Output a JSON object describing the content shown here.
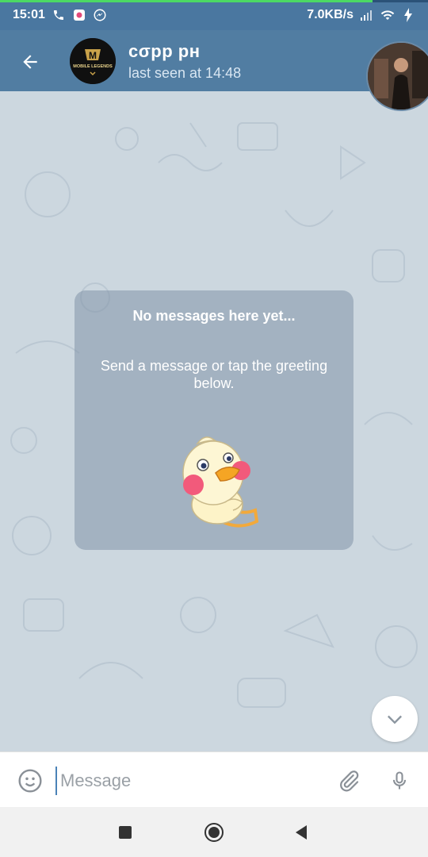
{
  "status_bar": {
    "time": "15:01",
    "net_speed": "7.0KB/s",
    "download_progress": 0.87,
    "icons_left": [
      "phone-icon",
      "gallery-icon",
      "messenger-icon"
    ],
    "icons_right": [
      "signal-icon",
      "wifi-icon",
      "charging-icon"
    ]
  },
  "header": {
    "title": "cσpp pн",
    "subtitle": "last seen at 14:48",
    "avatar_text": "MOBILE LEGENDS",
    "icons": [
      "back-arrow-icon",
      "avatar-image",
      "profile-photo"
    ]
  },
  "empty_state": {
    "title": "No messages here yet...",
    "subtitle": "Send a message or tap the greeting below.",
    "sticker": "duck-sticker"
  },
  "input": {
    "placeholder": "Message",
    "icons": [
      "emoji-icon",
      "paperclip-icon",
      "microphone-icon"
    ]
  },
  "scroll_down": {
    "icon": "chevron-down-icon"
  },
  "nav": {
    "icons": [
      "recents-square-icon",
      "home-circle-icon",
      "back-triangle-icon"
    ]
  },
  "colors": {
    "header": "#517da2",
    "status_bar": "#4a77a0",
    "chat_bg": "#ccd7df",
    "accent": "#4a82b7"
  }
}
